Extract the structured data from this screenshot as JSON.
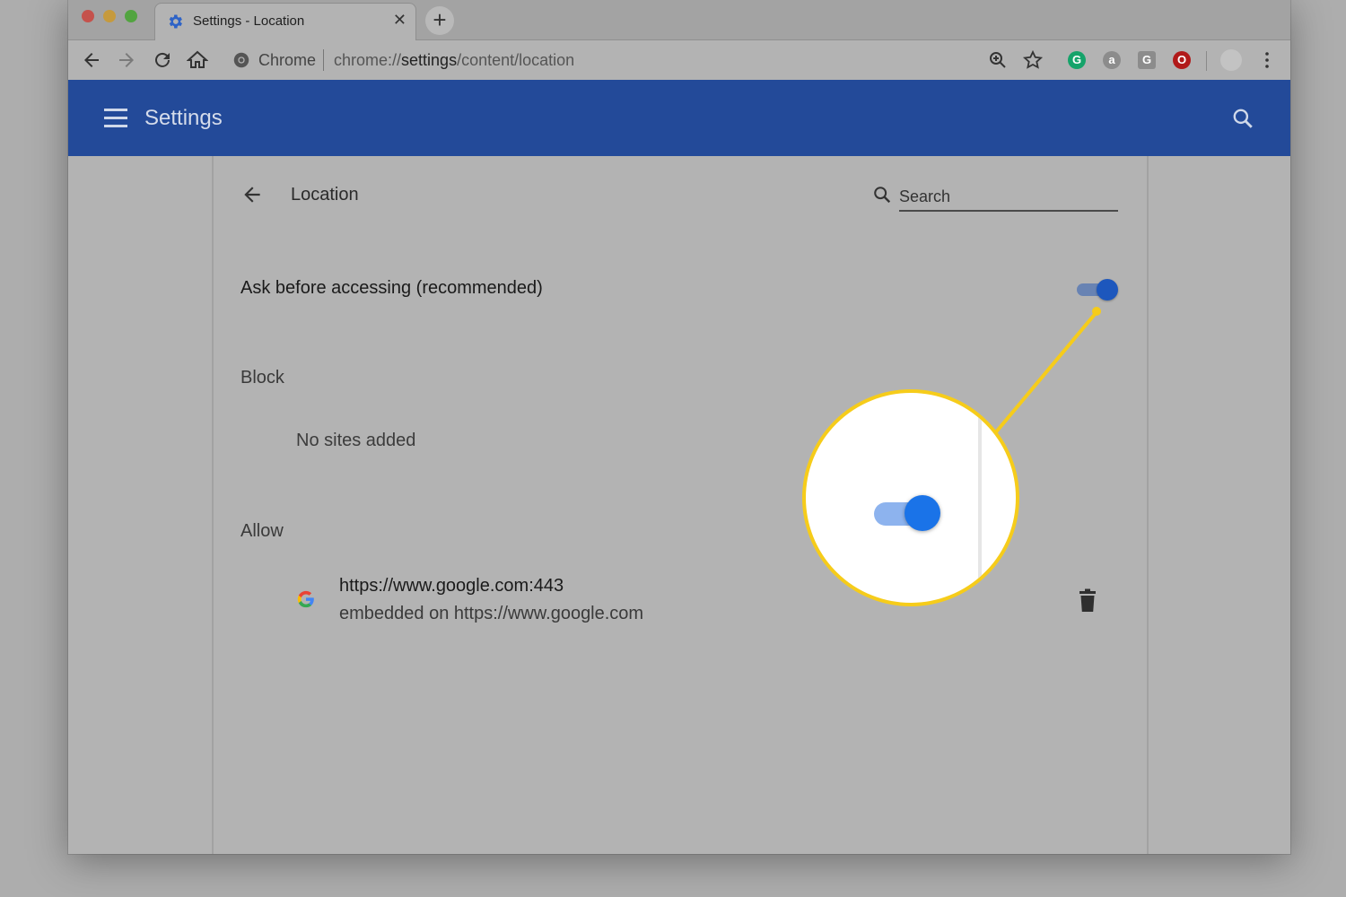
{
  "tab": {
    "title": "Settings - Location",
    "close_glyph": "✕",
    "new_tab_glyph": "+"
  },
  "omnibox": {
    "site": "Chrome",
    "url_prefix": "chrome://",
    "url_bold": "settings",
    "url_suffix": "/content/location"
  },
  "extensions": [
    {
      "name": "grammarly-icon",
      "glyph": "G",
      "color": "#15a36a"
    },
    {
      "name": "amazon-assistant-icon",
      "glyph": "a",
      "color": "#8c8c8c"
    },
    {
      "name": "google-translate-icon",
      "glyph": "G",
      "color": "#8c8c8c"
    },
    {
      "name": "opera-icon",
      "glyph": "O",
      "color": "#b11a1a"
    }
  ],
  "appbar": {
    "title": "Settings"
  },
  "page": {
    "title": "Location",
    "search_placeholder": "Search",
    "ask_label": "Ask before accessing (recommended)",
    "ask_enabled": true,
    "block_heading": "Block",
    "block_empty": "No sites added",
    "allow_heading": "Allow",
    "allow_sites": [
      {
        "url": "https://www.google.com:443",
        "embedded": "embedded on https://www.google.com"
      }
    ]
  },
  "colors": {
    "accent": "#234a99",
    "toggle_on": "#1a73e8",
    "callout": "#f6cc1a"
  }
}
